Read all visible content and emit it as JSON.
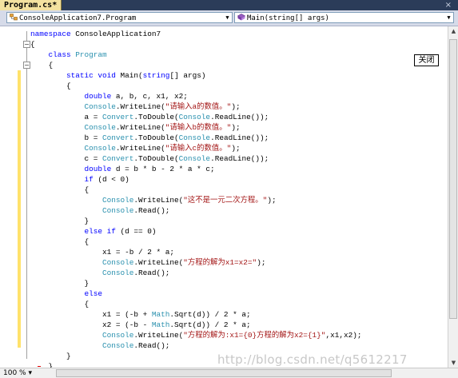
{
  "tab": {
    "title": "Program.cs*",
    "close_glyph": "×"
  },
  "navbar": {
    "class_combo": {
      "icon": "class-icon",
      "value": "ConsoleApplication7.Program"
    },
    "member_combo": {
      "icon": "method-icon",
      "value": "Main(string[] args)"
    },
    "dropdown_glyph": "▼"
  },
  "popup": {
    "label": "关闭"
  },
  "status": {
    "zoom": "100 %",
    "zoom_arrow": "▾"
  },
  "watermark": "http://blog.csdn.net/q5612217",
  "colors": {
    "keyword": "#0000ff",
    "type": "#2b91af",
    "string": "#a31515",
    "changed_line": "#ffe26b"
  },
  "code": {
    "lines": [
      [
        {
          "t": "namespace ",
          "c": "kw"
        },
        {
          "t": "ConsoleApplication7",
          "c": ""
        }
      ],
      [
        {
          "t": "{",
          "c": ""
        }
      ],
      [
        {
          "t": "    ",
          "c": ""
        },
        {
          "t": "class ",
          "c": "kw"
        },
        {
          "t": "Program",
          "c": "ty"
        }
      ],
      [
        {
          "t": "    {",
          "c": ""
        }
      ],
      [
        {
          "t": "        ",
          "c": ""
        },
        {
          "t": "static void ",
          "c": "kw"
        },
        {
          "t": "Main(",
          "c": ""
        },
        {
          "t": "string",
          "c": "kw"
        },
        {
          "t": "[] args)",
          "c": ""
        }
      ],
      [
        {
          "t": "        {",
          "c": ""
        }
      ],
      [
        {
          "t": "            ",
          "c": ""
        },
        {
          "t": "double",
          "c": "kw"
        },
        {
          "t": " a, b, c, x1, x2;",
          "c": ""
        }
      ],
      [
        {
          "t": "            ",
          "c": ""
        },
        {
          "t": "Console",
          "c": "ty"
        },
        {
          "t": ".WriteLine(",
          "c": ""
        },
        {
          "t": "\"请输入a的数值。\"",
          "c": "st"
        },
        {
          "t": ");",
          "c": ""
        }
      ],
      [
        {
          "t": "            a = ",
          "c": ""
        },
        {
          "t": "Convert",
          "c": "ty"
        },
        {
          "t": ".ToDouble(",
          "c": ""
        },
        {
          "t": "Console",
          "c": "ty"
        },
        {
          "t": ".ReadLine());",
          "c": ""
        }
      ],
      [
        {
          "t": "            ",
          "c": ""
        },
        {
          "t": "Console",
          "c": "ty"
        },
        {
          "t": ".WriteLine(",
          "c": ""
        },
        {
          "t": "\"请输入b的数值。\"",
          "c": "st"
        },
        {
          "t": ");",
          "c": ""
        }
      ],
      [
        {
          "t": "            b = ",
          "c": ""
        },
        {
          "t": "Convert",
          "c": "ty"
        },
        {
          "t": ".ToDouble(",
          "c": ""
        },
        {
          "t": "Console",
          "c": "ty"
        },
        {
          "t": ".ReadLine());",
          "c": ""
        }
      ],
      [
        {
          "t": "            ",
          "c": ""
        },
        {
          "t": "Console",
          "c": "ty"
        },
        {
          "t": ".WriteLine(",
          "c": ""
        },
        {
          "t": "\"请输入c的数值。\"",
          "c": "st"
        },
        {
          "t": ");",
          "c": ""
        }
      ],
      [
        {
          "t": "            c = ",
          "c": ""
        },
        {
          "t": "Convert",
          "c": "ty"
        },
        {
          "t": ".ToDouble(",
          "c": ""
        },
        {
          "t": "Console",
          "c": "ty"
        },
        {
          "t": ".ReadLine());",
          "c": ""
        }
      ],
      [
        {
          "t": "            ",
          "c": ""
        },
        {
          "t": "double",
          "c": "kw"
        },
        {
          "t": " d = b * b - 2 * a * c;",
          "c": ""
        }
      ],
      [
        {
          "t": "            ",
          "c": ""
        },
        {
          "t": "if",
          "c": "kw"
        },
        {
          "t": " (d < 0)",
          "c": ""
        }
      ],
      [
        {
          "t": "            {",
          "c": ""
        }
      ],
      [
        {
          "t": "                ",
          "c": ""
        },
        {
          "t": "Console",
          "c": "ty"
        },
        {
          "t": ".WriteLine(",
          "c": ""
        },
        {
          "t": "\"这不是一元二次方程。\"",
          "c": "st"
        },
        {
          "t": ");",
          "c": ""
        }
      ],
      [
        {
          "t": "                ",
          "c": ""
        },
        {
          "t": "Console",
          "c": "ty"
        },
        {
          "t": ".Read();",
          "c": ""
        }
      ],
      [
        {
          "t": "            }",
          "c": ""
        }
      ],
      [
        {
          "t": "            ",
          "c": ""
        },
        {
          "t": "else if",
          "c": "kw"
        },
        {
          "t": " (d == 0)",
          "c": ""
        }
      ],
      [
        {
          "t": "            {",
          "c": ""
        }
      ],
      [
        {
          "t": "                x1 = -b / 2 * a;",
          "c": ""
        }
      ],
      [
        {
          "t": "                ",
          "c": ""
        },
        {
          "t": "Console",
          "c": "ty"
        },
        {
          "t": ".WriteLine(",
          "c": ""
        },
        {
          "t": "\"方程的解为x1=x2=\"",
          "c": "st"
        },
        {
          "t": ");",
          "c": ""
        }
      ],
      [
        {
          "t": "                ",
          "c": ""
        },
        {
          "t": "Console",
          "c": "ty"
        },
        {
          "t": ".Read();",
          "c": ""
        }
      ],
      [
        {
          "t": "            }",
          "c": ""
        }
      ],
      [
        {
          "t": "            ",
          "c": ""
        },
        {
          "t": "else",
          "c": "kw"
        }
      ],
      [
        {
          "t": "            {",
          "c": ""
        }
      ],
      [
        {
          "t": "                x1 = (-b + ",
          "c": ""
        },
        {
          "t": "Math",
          "c": "ty"
        },
        {
          "t": ".Sqrt(d)) / 2 * a;",
          "c": ""
        }
      ],
      [
        {
          "t": "                x2 = (-b - ",
          "c": ""
        },
        {
          "t": "Math",
          "c": "ty"
        },
        {
          "t": ".Sqrt(d)) / 2 * a;",
          "c": ""
        }
      ],
      [
        {
          "t": "                ",
          "c": ""
        },
        {
          "t": "Console",
          "c": "ty"
        },
        {
          "t": ".WriteLine(",
          "c": ""
        },
        {
          "t": "\"方程的解为:x1={0}方程的解为x2={1}\"",
          "c": "st"
        },
        {
          "t": ",x1,x2);",
          "c": ""
        }
      ],
      [
        {
          "t": "                ",
          "c": ""
        },
        {
          "t": "Console",
          "c": "ty"
        },
        {
          "t": ".Read();",
          "c": ""
        }
      ],
      [
        {
          "t": "        }",
          "c": ""
        }
      ],
      [
        {
          "t": "    }",
          "c": ""
        }
      ],
      [
        {
          "t": "}",
          "c": ""
        }
      ]
    ]
  }
}
